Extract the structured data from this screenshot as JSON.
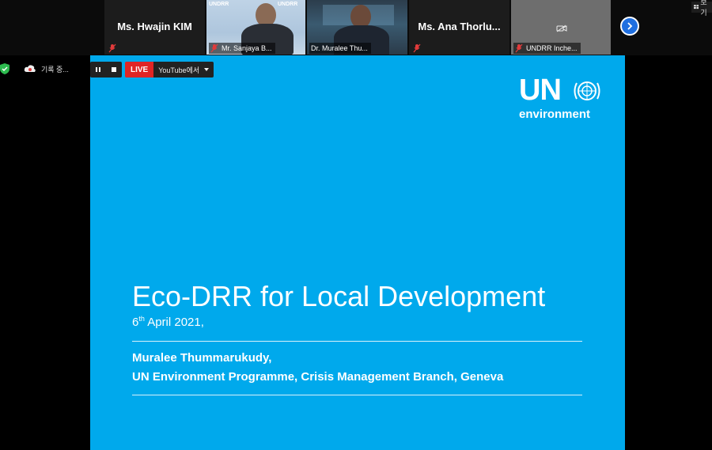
{
  "participants": [
    {
      "name": "Ms. Hwajin KIM",
      "muted": true,
      "video": false
    },
    {
      "name": "Mr. Sanjaya B...",
      "muted": true,
      "video": true,
      "banner": "UNDRR"
    },
    {
      "name": "Dr. Muralee Thu...",
      "muted": true,
      "video": true
    },
    {
      "name": "Ms. Ana Thorlu...",
      "muted": true,
      "video": false
    },
    {
      "name": "UNDRR Inche...",
      "muted": true,
      "video": false,
      "camera_off": true
    }
  ],
  "top_right": {
    "view_label": "보기"
  },
  "left_status": {
    "recording_label": "기록 중..."
  },
  "share_toolbar": {
    "live_label": "LIVE",
    "stream_target": "YouTube에서"
  },
  "slide": {
    "logo_un": "UN",
    "logo_env": "environment",
    "title": "Eco-DRR for Local Development",
    "date_day": "6",
    "date_sup": "th",
    "date_rest": " April 2021,",
    "author": "Muralee Thummarukudy,",
    "organization": "UN Environment Programme, Crisis Management Branch, Geneva"
  },
  "colors": {
    "slide_bg": "#00a9ec",
    "live_red": "#e02525",
    "nav_blue": "#1f6fe0"
  }
}
